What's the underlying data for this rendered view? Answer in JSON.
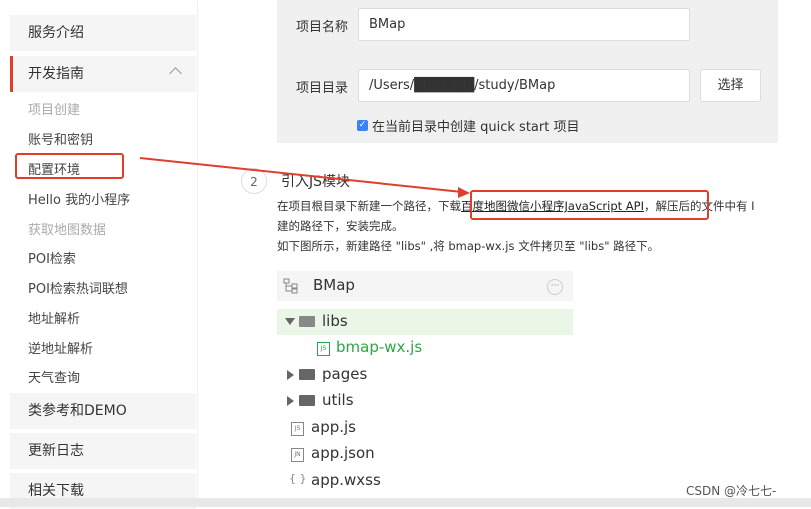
{
  "sidebar": {
    "service_intro": "服务介绍",
    "dev_guide": "开发指南",
    "sub_items": [
      "项目创建",
      "账号和密钥",
      "配置环境",
      "Hello 我的小程序",
      "获取地图数据",
      "POI检索",
      "POI检索热词联想",
      "地址解析",
      "逆地址解析",
      "天气查询"
    ],
    "ref_demo": "类参考和DEMO",
    "changelog": "更新日志",
    "downloads": "相关下载"
  },
  "form": {
    "project_name_label": "项目名称",
    "project_name_value": "BMap",
    "project_dir_label": "项目目录",
    "project_dir_value": "/Users/██████/study/BMap",
    "select_button": "选择",
    "checkbox_label": "在当前目录中创建 quick start 项目"
  },
  "step": {
    "number": "2",
    "title": "引入JS模块",
    "line1_pre": "在项目根目录下新建一个路径，下载",
    "line1_link": "百度地图微信小程序JavaScript API",
    "line1_post": "，解压后的文件中有 I",
    "line2": "建的路径下，安装完成。",
    "line3": "如下图所示，新建路径 \"libs\" ,将 bmap-wx.js 文件拷贝至 \"libs\" 路径下。"
  },
  "tree": {
    "title": "BMap",
    "more": "···",
    "rows": [
      "libs",
      "bmap-wx.js",
      "pages",
      "utils",
      "app.js",
      "app.json",
      "app.wxss"
    ]
  },
  "watermark": "CSDN @冷七七-",
  "colors": {
    "accent_red": "#e03e2d",
    "green_file": "#2aa745",
    "selected_bg": "#eaf6e6"
  }
}
